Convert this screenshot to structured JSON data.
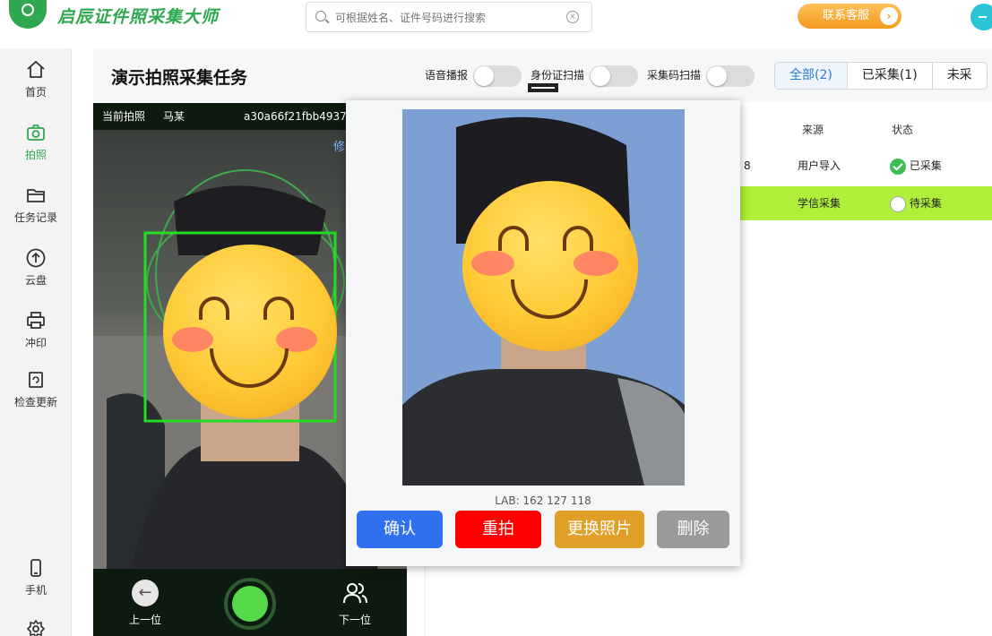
{
  "header": {
    "app_title": "启辰证件照采集大师",
    "search_placeholder": "可根据姓名、证件号码进行搜索",
    "support_label": "联系客服"
  },
  "sidebar": {
    "items": [
      {
        "label": "首页",
        "icon": "home-icon",
        "active": false
      },
      {
        "label": "拍照",
        "icon": "camera-icon",
        "active": true
      },
      {
        "label": "任务记录",
        "icon": "folder-icon",
        "active": false
      },
      {
        "label": "云盘",
        "icon": "upload-icon",
        "active": false
      },
      {
        "label": "冲印",
        "icon": "printer-icon",
        "active": false
      },
      {
        "label": "检查更新",
        "icon": "refresh-icon",
        "active": false
      },
      {
        "label": "手机",
        "icon": "phone-icon",
        "active": false
      }
    ],
    "settings_icon": "gear-icon"
  },
  "main": {
    "title": "演示拍照采集任务",
    "toggles": [
      {
        "label": "语音播报",
        "on": false
      },
      {
        "label": "身份证扫描",
        "on": false
      },
      {
        "label": "采集码扫描",
        "on": false
      }
    ],
    "tabs": [
      {
        "label": "全部(2)",
        "active": true
      },
      {
        "label": "已采集(1)",
        "active": false
      },
      {
        "label": "未采",
        "active": false
      }
    ]
  },
  "table": {
    "columns": [
      "来源",
      "状态"
    ],
    "rows": [
      {
        "partial": "8",
        "source": "用户导入",
        "status": "已采集",
        "done": true,
        "highlight": false
      },
      {
        "partial": "",
        "source": "学信采集",
        "status": "待采集",
        "done": false,
        "highlight": true
      }
    ]
  },
  "camera": {
    "label": "当前拍照",
    "name": "马某",
    "id": "a30a66f21fbb4937",
    "edge_text": "修",
    "prev_label": "上一位",
    "next_label": "下一位"
  },
  "preview": {
    "lab_text": "LAB: 162 127 118",
    "buttons": [
      {
        "label": "确认",
        "color": "#2f6ff0"
      },
      {
        "label": "重拍",
        "color": "#ff0000"
      },
      {
        "label": "更换照片",
        "color": "#e0a028"
      },
      {
        "label": "删除",
        "color": "#9a9a9a"
      }
    ]
  },
  "colors": {
    "brand_green": "#2fa84f",
    "accent_blue": "#2b7bd6",
    "highlight_row": "#b0ef3a",
    "face_box": "#22dd22"
  }
}
